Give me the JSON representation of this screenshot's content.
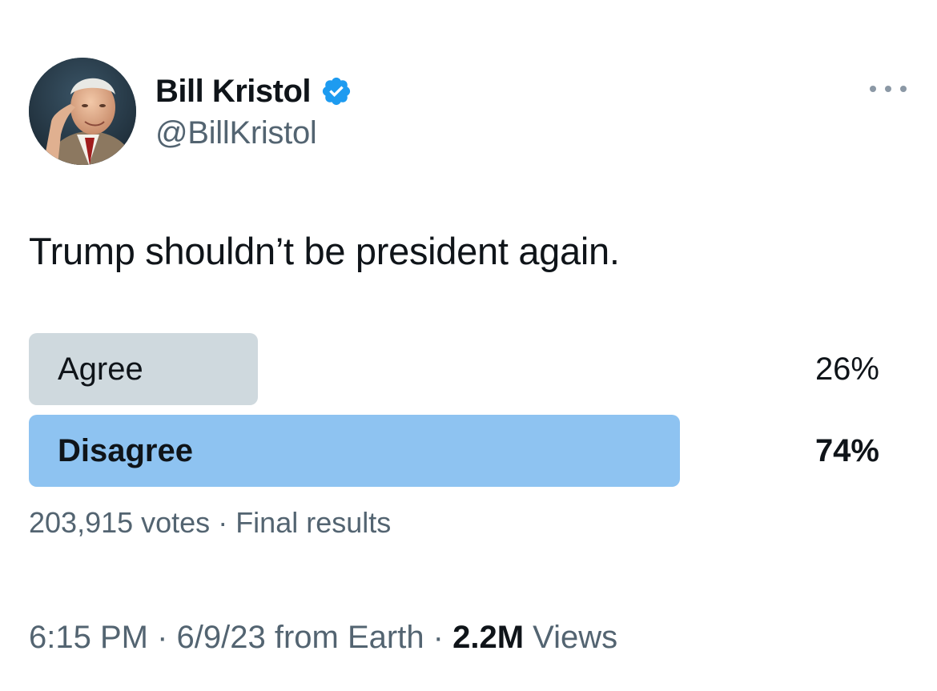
{
  "author": {
    "display_name": "Bill Kristol",
    "handle": "@BillKristol",
    "verified": true,
    "verified_icon": "verified-badge-icon",
    "verified_color": "#1d9bf0",
    "avatar_icon": "profile-photo"
  },
  "menu": {
    "icon": "more-options-icon"
  },
  "tweet": {
    "text": "Trump shouldn’t be president again."
  },
  "poll": {
    "options": [
      {
        "label": "Agree",
        "percent_text": "26%",
        "share": 0.26,
        "winner": false
      },
      {
        "label": "Disagree",
        "percent_text": "74%",
        "share": 0.74,
        "winner": true
      }
    ],
    "votes_text": "203,915 votes",
    "separator": " · ",
    "status_text": "Final results",
    "bar_color": "#cfd9de",
    "winner_bar_color": "#8ec3f1"
  },
  "meta": {
    "time": "6:15 PM",
    "separator": " · ",
    "date_source": "6/9/23 from Earth",
    "views_count": "2.2M",
    "views_label": " Views"
  }
}
